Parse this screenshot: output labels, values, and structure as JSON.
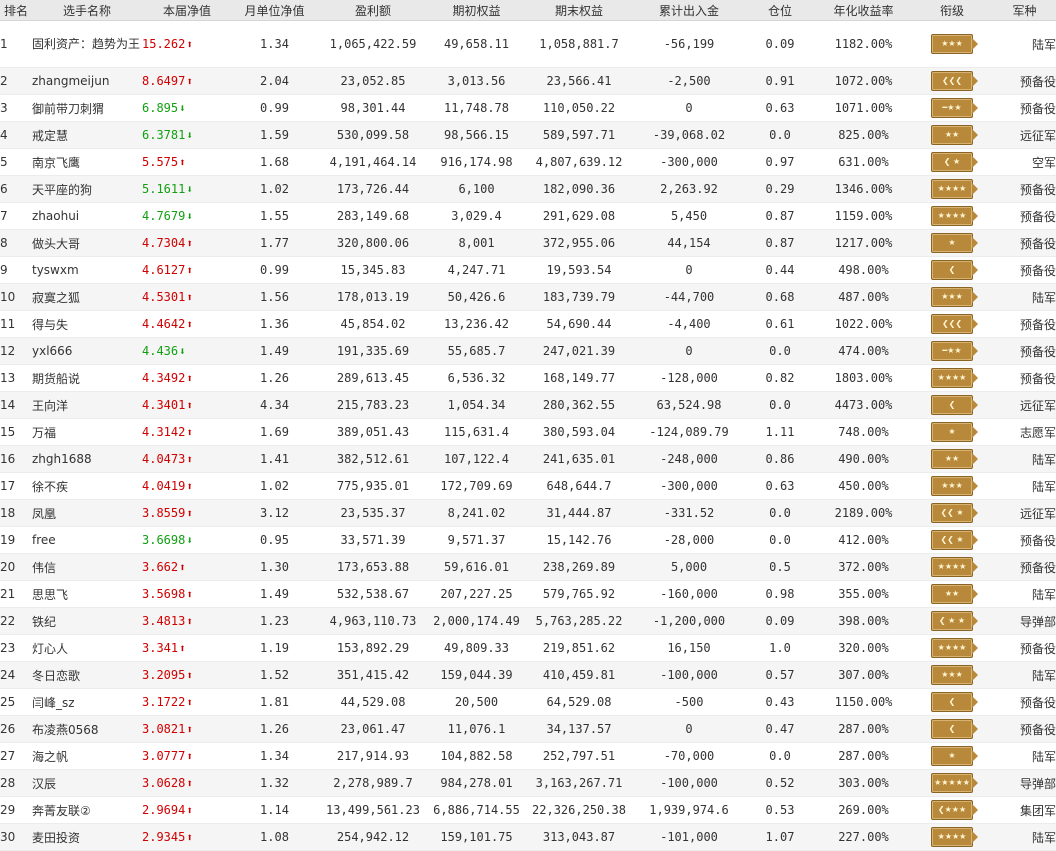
{
  "headers": [
    "排名",
    "选手名称",
    "本届净值",
    "月单位净值",
    "盈利额",
    "期初权益",
    "期末权益",
    "累计出入金",
    "仓位",
    "年化收益率",
    "衔级",
    "军种"
  ],
  "colors": {
    "up": "#d10000",
    "down": "#12a012",
    "badge": "#b8893b",
    "header_bg": "#e9e9e9",
    "even_row_bg": "#f5f5f5"
  },
  "rows": [
    {
      "rank": "1",
      "name": "固利资产：趋势为王",
      "nav": "15.262",
      "dir": "up",
      "monthly": "1.34",
      "profit": "1,065,422.59",
      "start": "49,658.11",
      "end": "1,058,881.7",
      "flow": "-56,199",
      "position": "0.09",
      "annual": "1182.00%",
      "badge": "★★★",
      "army": "陆军"
    },
    {
      "rank": "2",
      "name": "zhangmeijun",
      "nav": "8.6497",
      "dir": "up",
      "monthly": "2.04",
      "profit": "23,052.85",
      "start": "3,013.56",
      "end": "23,566.41",
      "flow": "-2,500",
      "position": "0.91",
      "annual": "1072.00%",
      "badge": "❮❮❮",
      "army": "预备役"
    },
    {
      "rank": "3",
      "name": "御前带刀刺猬",
      "nav": "6.895",
      "dir": "down",
      "monthly": "0.99",
      "profit": "98,301.44",
      "start": "11,748.78",
      "end": "110,050.22",
      "flow": "0",
      "position": "0.63",
      "annual": "1071.00%",
      "badge": "━★★",
      "army": "预备役"
    },
    {
      "rank": "4",
      "name": "戒定慧",
      "nav": "6.3781",
      "dir": "down",
      "monthly": "1.59",
      "profit": "530,099.58",
      "start": "98,566.15",
      "end": "589,597.71",
      "flow": "-39,068.02",
      "position": "0.0",
      "annual": "825.00%",
      "badge": "★★",
      "army": "远征军"
    },
    {
      "rank": "5",
      "name": "南京飞鹰",
      "nav": "5.575",
      "dir": "up",
      "monthly": "1.68",
      "profit": "4,191,464.14",
      "start": "916,174.98",
      "end": "4,807,639.12",
      "flow": "-300,000",
      "position": "0.97",
      "annual": "631.00%",
      "badge": "❮ ★",
      "army": "空军"
    },
    {
      "rank": "6",
      "name": "天平座的狗",
      "nav": "5.1611",
      "dir": "down",
      "monthly": "1.02",
      "profit": "173,726.44",
      "start": "6,100",
      "end": "182,090.36",
      "flow": "2,263.92",
      "position": "0.29",
      "annual": "1346.00%",
      "badge": "★★★★",
      "army": "预备役"
    },
    {
      "rank": "7",
      "name": "zhaohui",
      "nav": "4.7679",
      "dir": "down",
      "monthly": "1.55",
      "profit": "283,149.68",
      "start": "3,029.4",
      "end": "291,629.08",
      "flow": "5,450",
      "position": "0.87",
      "annual": "1159.00%",
      "badge": "★★★★",
      "army": "预备役"
    },
    {
      "rank": "8",
      "name": "做头大哥",
      "nav": "4.7304",
      "dir": "up",
      "monthly": "1.77",
      "profit": "320,800.06",
      "start": "8,001",
      "end": "372,955.06",
      "flow": "44,154",
      "position": "0.87",
      "annual": "1217.00%",
      "badge": "★",
      "army": "预备役"
    },
    {
      "rank": "9",
      "name": "tyswxm",
      "nav": "4.6127",
      "dir": "up",
      "monthly": "0.99",
      "profit": "15,345.83",
      "start": "4,247.71",
      "end": "19,593.54",
      "flow": "0",
      "position": "0.44",
      "annual": "498.00%",
      "badge": "❮",
      "army": "预备役"
    },
    {
      "rank": "10",
      "name": "寂寞之狐",
      "nav": "4.5301",
      "dir": "up",
      "monthly": "1.56",
      "profit": "178,013.19",
      "start": "50,426.6",
      "end": "183,739.79",
      "flow": "-44,700",
      "position": "0.68",
      "annual": "487.00%",
      "badge": "★★★",
      "army": "陆军"
    },
    {
      "rank": "11",
      "name": "得与失",
      "nav": "4.4642",
      "dir": "up",
      "monthly": "1.36",
      "profit": "45,854.02",
      "start": "13,236.42",
      "end": "54,690.44",
      "flow": "-4,400",
      "position": "0.61",
      "annual": "1022.00%",
      "badge": "❮❮❮",
      "army": "预备役"
    },
    {
      "rank": "12",
      "name": "yxl666",
      "nav": "4.436",
      "dir": "down",
      "monthly": "1.49",
      "profit": "191,335.69",
      "start": "55,685.7",
      "end": "247,021.39",
      "flow": "0",
      "position": "0.0",
      "annual": "474.00%",
      "badge": "━★★",
      "army": "预备役"
    },
    {
      "rank": "13",
      "name": "期货船说",
      "nav": "4.3492",
      "dir": "up",
      "monthly": "1.26",
      "profit": "289,613.45",
      "start": "6,536.32",
      "end": "168,149.77",
      "flow": "-128,000",
      "position": "0.82",
      "annual": "1803.00%",
      "badge": "★★★★",
      "army": "预备役"
    },
    {
      "rank": "14",
      "name": "王向洋",
      "nav": "4.3401",
      "dir": "up",
      "monthly": "4.34",
      "profit": "215,783.23",
      "start": "1,054.34",
      "end": "280,362.55",
      "flow": "63,524.98",
      "position": "0.0",
      "annual": "4473.00%",
      "badge": "❮",
      "army": "远征军"
    },
    {
      "rank": "15",
      "name": "万福",
      "nav": "4.3142",
      "dir": "up",
      "monthly": "1.69",
      "profit": "389,051.43",
      "start": "115,631.4",
      "end": "380,593.04",
      "flow": "-124,089.79",
      "position": "1.11",
      "annual": "748.00%",
      "badge": "★",
      "army": "志愿军"
    },
    {
      "rank": "16",
      "name": "zhgh1688",
      "nav": "4.0473",
      "dir": "up",
      "monthly": "1.41",
      "profit": "382,512.61",
      "start": "107,122.4",
      "end": "241,635.01",
      "flow": "-248,000",
      "position": "0.86",
      "annual": "490.00%",
      "badge": "★★",
      "army": "陆军"
    },
    {
      "rank": "17",
      "name": "徐不疾",
      "nav": "4.0419",
      "dir": "up",
      "monthly": "1.02",
      "profit": "775,935.01",
      "start": "172,709.69",
      "end": "648,644.7",
      "flow": "-300,000",
      "position": "0.63",
      "annual": "450.00%",
      "badge": "★★★",
      "army": "陆军"
    },
    {
      "rank": "18",
      "name": "凤凰",
      "nav": "3.8559",
      "dir": "up",
      "monthly": "3.12",
      "profit": "23,535.37",
      "start": "8,241.02",
      "end": "31,444.87",
      "flow": "-331.52",
      "position": "0.0",
      "annual": "2189.00%",
      "badge": "❮❮ ★",
      "army": "远征军"
    },
    {
      "rank": "19",
      "name": "free",
      "nav": "3.6698",
      "dir": "down",
      "monthly": "0.95",
      "profit": "33,571.39",
      "start": "9,571.37",
      "end": "15,142.76",
      "flow": "-28,000",
      "position": "0.0",
      "annual": "412.00%",
      "badge": "❮❮ ★",
      "army": "预备役"
    },
    {
      "rank": "20",
      "name": "伟信",
      "nav": "3.662",
      "dir": "up",
      "monthly": "1.30",
      "profit": "173,653.88",
      "start": "59,616.01",
      "end": "238,269.89",
      "flow": "5,000",
      "position": "0.5",
      "annual": "372.00%",
      "badge": "★★★★",
      "army": "预备役"
    },
    {
      "rank": "21",
      "name": "思思飞",
      "nav": "3.5698",
      "dir": "up",
      "monthly": "1.49",
      "profit": "532,538.67",
      "start": "207,227.25",
      "end": "579,765.92",
      "flow": "-160,000",
      "position": "0.98",
      "annual": "355.00%",
      "badge": "★★",
      "army": "陆军"
    },
    {
      "rank": "22",
      "name": "铁纪",
      "nav": "3.4813",
      "dir": "up",
      "monthly": "1.23",
      "profit": "4,963,110.73",
      "start": "2,000,174.49",
      "end": "5,763,285.22",
      "flow": "-1,200,000",
      "position": "0.09",
      "annual": "398.00%",
      "badge": "❮ ★ ★",
      "army": "导弹部"
    },
    {
      "rank": "23",
      "name": "灯心人",
      "nav": "3.341",
      "dir": "up",
      "monthly": "1.19",
      "profit": "153,892.29",
      "start": "49,809.33",
      "end": "219,851.62",
      "flow": "16,150",
      "position": "1.0",
      "annual": "320.00%",
      "badge": "★★★★",
      "army": "预备役"
    },
    {
      "rank": "24",
      "name": "冬日恋歌",
      "nav": "3.2095",
      "dir": "up",
      "monthly": "1.52",
      "profit": "351,415.42",
      "start": "159,044.39",
      "end": "410,459.81",
      "flow": "-100,000",
      "position": "0.57",
      "annual": "307.00%",
      "badge": "★★★",
      "army": "陆军"
    },
    {
      "rank": "25",
      "name": "闫峰_sz",
      "nav": "3.1722",
      "dir": "up",
      "monthly": "1.81",
      "profit": "44,529.08",
      "start": "20,500",
      "end": "64,529.08",
      "flow": "-500",
      "position": "0.43",
      "annual": "1150.00%",
      "badge": "❮",
      "army": "预备役"
    },
    {
      "rank": "26",
      "name": "布凌燕0568",
      "nav": "3.0821",
      "dir": "up",
      "monthly": "1.26",
      "profit": "23,061.47",
      "start": "11,076.1",
      "end": "34,137.57",
      "flow": "0",
      "position": "0.47",
      "annual": "287.00%",
      "badge": "❮",
      "army": "预备役"
    },
    {
      "rank": "27",
      "name": "海之帆",
      "nav": "3.0777",
      "dir": "up",
      "monthly": "1.34",
      "profit": "217,914.93",
      "start": "104,882.58",
      "end": "252,797.51",
      "flow": "-70,000",
      "position": "0.0",
      "annual": "287.00%",
      "badge": "★",
      "army": "陆军"
    },
    {
      "rank": "28",
      "name": "汉辰",
      "nav": "3.0628",
      "dir": "up",
      "monthly": "1.32",
      "profit": "2,278,989.7",
      "start": "984,278.01",
      "end": "3,163,267.71",
      "flow": "-100,000",
      "position": "0.52",
      "annual": "303.00%",
      "badge": "★★★★★",
      "army": "导弹部"
    },
    {
      "rank": "29",
      "name": "奔菁友联②",
      "nav": "2.9694",
      "dir": "up",
      "monthly": "1.14",
      "profit": "13,499,561.23",
      "start": "6,886,714.55",
      "end": "22,326,250.38",
      "flow": "1,939,974.6",
      "position": "0.53",
      "annual": "269.00%",
      "badge": "❮★★★",
      "army": "集团军"
    },
    {
      "rank": "30",
      "name": "麦田投资",
      "nav": "2.9345",
      "dir": "up",
      "monthly": "1.08",
      "profit": "254,942.12",
      "start": "159,101.75",
      "end": "313,043.87",
      "flow": "-101,000",
      "position": "1.07",
      "annual": "227.00%",
      "badge": "★★★★",
      "army": "陆军"
    }
  ]
}
